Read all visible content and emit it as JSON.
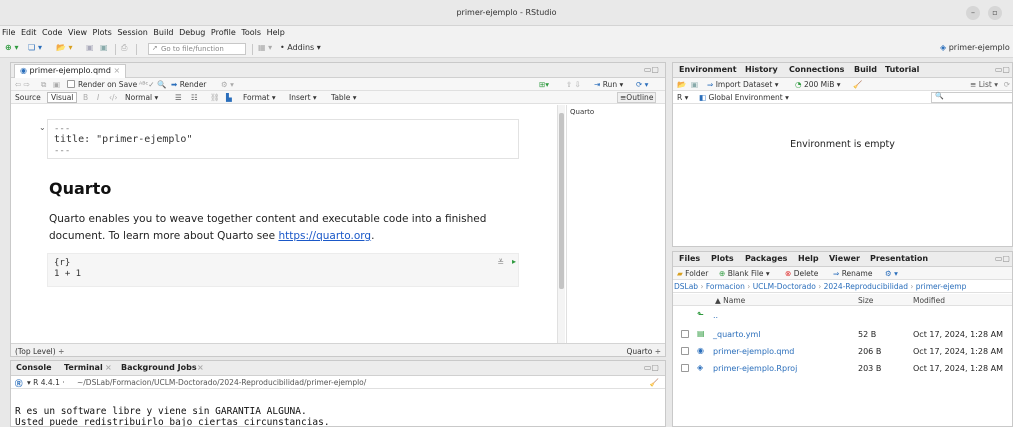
{
  "window": {
    "title": "primer-ejemplo - RStudio"
  },
  "menu": [
    "File",
    "Edit",
    "Code",
    "View",
    "Plots",
    "Session",
    "Build",
    "Debug",
    "Profile",
    "Tools",
    "Help"
  ],
  "main_toolbar": {
    "goto_placeholder": "Go to file/function",
    "addins_label": "Addins",
    "project_label": "primer-ejemplo"
  },
  "editor": {
    "tab_label": "primer-ejemplo.qmd",
    "render_on_save": "Render on Save",
    "render": "Render",
    "run": "Run",
    "source_label": "Source",
    "visual_label": "Visual",
    "style_select": "Normal",
    "format_menu": "Format",
    "insert_menu": "Insert",
    "table_menu": "Table",
    "outline_btn": "Outline",
    "yaml_dash_open": "---",
    "yaml_title": "title: \"primer-ejemplo\"",
    "yaml_dash_close": "---",
    "heading": "Quarto",
    "para_pre": "Quarto enables you to weave together content and executable code into a finished document. To learn more about Quarto see ",
    "para_link": "https://quarto.org",
    "para_post": ".",
    "chunk_header": "{r}",
    "chunk_code": "1 + 1",
    "outline_heading": "Quarto",
    "status_left": "(Top Level) ÷",
    "status_right": "Quarto ÷"
  },
  "console": {
    "tabs": [
      "Console",
      "Terminal",
      "Background Jobs"
    ],
    "version": "R 4.4.1",
    "path": "~/DSLab/Formacion/UCLM-Doctorado/2024-Reproducibilidad/primer-ejemplo/",
    "line1": "R es un software libre y viene sin GARANTIA ALGUNA.",
    "line2": "Usted puede redistribuirlo bajo ciertas circunstancias."
  },
  "environment": {
    "tabs": [
      "Environment",
      "History",
      "Connections",
      "Build",
      "Tutorial"
    ],
    "import_dataset": "Import Dataset",
    "memory": "200 MiB",
    "list_label": "List",
    "lang": "R",
    "global_env": "Global Environment",
    "empty_msg": "Environment is empty"
  },
  "files": {
    "tabs": [
      "Files",
      "Plots",
      "Packages",
      "Help",
      "Viewer",
      "Presentation"
    ],
    "folder_btn": "Folder",
    "blank_file_btn": "Blank File",
    "delete_btn": "Delete",
    "rename_btn": "Rename",
    "breadcrumb": [
      "DSLab",
      "Formacion",
      "UCLM-Doctorado",
      "2024-Reproducibilidad",
      "primer-ejemp"
    ],
    "columns": {
      "name": "▲ Name",
      "size": "Size",
      "modified": "Modified"
    },
    "parent_dir": "..",
    "rows": [
      {
        "name": "_quarto.yml",
        "size": "52 B",
        "modified": "Oct 17, 2024, 1:28 AM",
        "icon": "yml-file-icon"
      },
      {
        "name": "primer-ejemplo.qmd",
        "size": "206 B",
        "modified": "Oct 17, 2024, 1:28 AM",
        "icon": "qmd-file-icon"
      },
      {
        "name": "primer-ejemplo.Rproj",
        "size": "203 B",
        "modified": "Oct 17, 2024, 1:28 AM",
        "icon": "rproj-file-icon"
      }
    ]
  },
  "colors": {
    "accent_blue": "#1a58c8",
    "r_blue": "#2a6ebb",
    "green": "#2e9a3e",
    "red": "#d22"
  }
}
